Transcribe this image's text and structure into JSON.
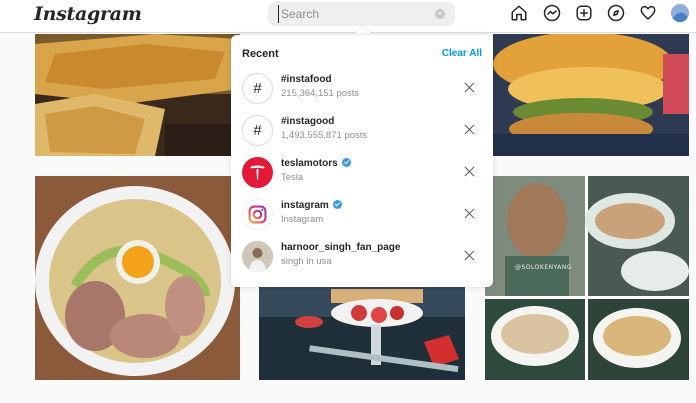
{
  "header": {
    "logo": "Instagram",
    "search_placeholder": "Search",
    "search_clear_glyph": "×",
    "nav_icons": [
      "home-icon",
      "messenger-icon",
      "new-post-icon",
      "explore-icon",
      "activity-heart-icon"
    ],
    "profile_avatar": "profile-avatar"
  },
  "search_dropdown": {
    "heading": "Recent",
    "clear_all": "Clear All",
    "items": [
      {
        "icon": "#",
        "title": "#instafood",
        "subtitle": "215,364,151 posts",
        "type": "hashtag",
        "verified": false
      },
      {
        "icon": "#",
        "title": "#instagood",
        "subtitle": "1,493,555,871 posts",
        "type": "hashtag",
        "verified": false
      },
      {
        "icon": "tesla-logo",
        "title": "teslamotors",
        "subtitle": "Tesla",
        "type": "account",
        "verified": true
      },
      {
        "icon": "instagram-logo",
        "title": "instagram",
        "subtitle": "Instagram",
        "type": "account",
        "verified": true
      },
      {
        "icon": "user-photo",
        "title": "harnoor_singh_fan_page",
        "subtitle": "singh in usa",
        "type": "account",
        "verified": false
      }
    ]
  },
  "feed_tiles": [
    {
      "name": "quesadilla-tile"
    },
    {
      "name": "burger-tile"
    },
    {
      "name": "ramen-bowl-tile"
    },
    {
      "name": "dessert-tile"
    },
    {
      "name": "street-food-collage-tile",
      "watermark": "@SOLOKENYANG"
    }
  ],
  "colors": {
    "accent": "#0095f6",
    "verified": "#3897f0",
    "tesla": "#e31937",
    "border": "#dbdbdb"
  }
}
